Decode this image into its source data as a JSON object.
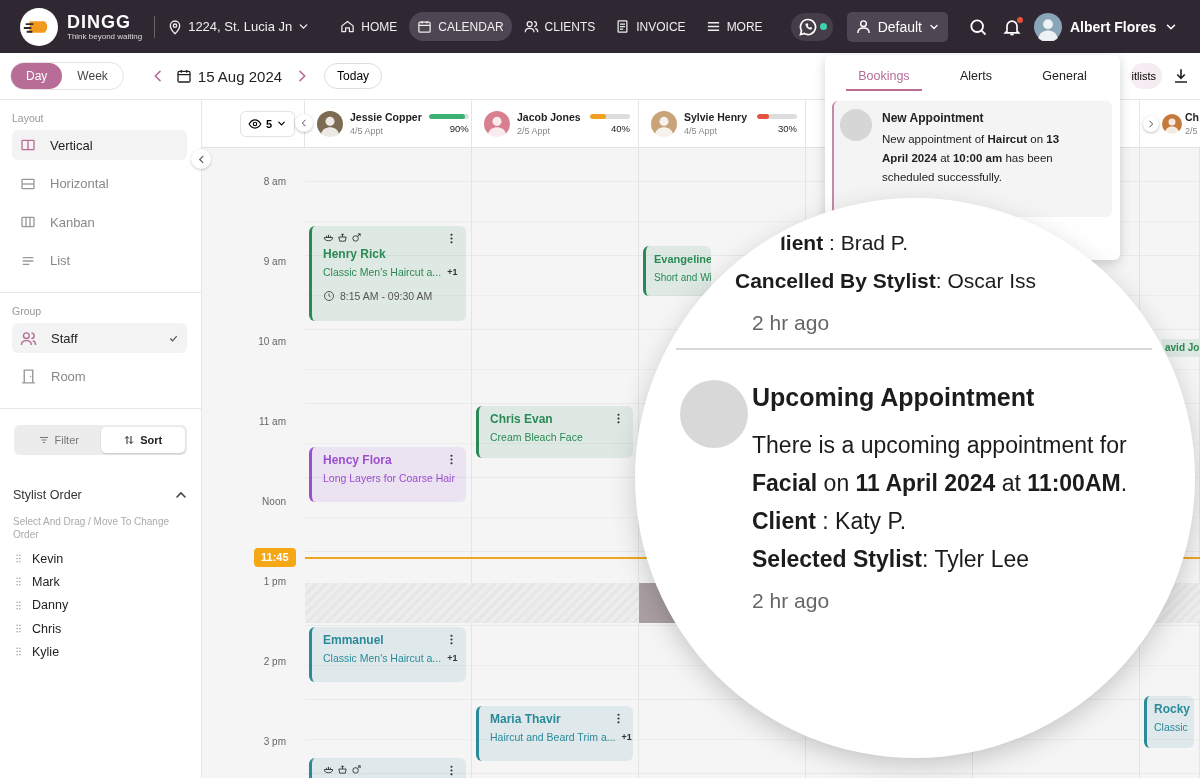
{
  "brand": {
    "name": "DINGG",
    "tagline": "Think beyond waiting"
  },
  "location": "1224, St. Lucia Jn",
  "nav": [
    {
      "label": "HOME",
      "selected": false
    },
    {
      "label": "CALENDAR",
      "selected": true
    },
    {
      "label": "CLIENTS",
      "selected": false
    },
    {
      "label": "INVOICE",
      "selected": false
    },
    {
      "label": "MORE",
      "selected": false
    }
  ],
  "whatsapp": {
    "online": true
  },
  "profile_switch": "Default",
  "bell": {
    "unread": true
  },
  "user": "Albert Flores",
  "view_toggle": [
    {
      "label": "Day",
      "selected": true
    },
    {
      "label": "Week",
      "selected": false
    }
  ],
  "date": "15 Aug 2024",
  "today": "Today",
  "waitlists": "itlists",
  "sidebar": {
    "layout_label": "Layout",
    "layouts": [
      {
        "label": "Vertical",
        "selected": true
      },
      {
        "label": "Horizontal",
        "selected": false
      },
      {
        "label": "Kanban",
        "selected": false
      },
      {
        "label": "List",
        "selected": false
      }
    ],
    "group_label": "Group",
    "groups": [
      {
        "label": "Staff",
        "selected": true
      },
      {
        "label": "Room",
        "selected": false
      }
    ],
    "modes": [
      {
        "label": "Filter",
        "selected": false
      },
      {
        "label": "Sort",
        "selected": true
      }
    ],
    "order": {
      "title": "Stylist Order",
      "expanded": true,
      "hint": "Select And Drag / Move To Change Order",
      "items": [
        "Kevin",
        "Mark",
        "Danny",
        "Chris",
        "Kylie"
      ]
    }
  },
  "calendar": {
    "visible_count": "5",
    "times": [
      "8 am",
      "9 am",
      "10 am",
      "11 am",
      "Noon",
      "1 pm",
      "2 pm",
      "3 pm"
    ],
    "now": "11:45",
    "staff": [
      {
        "name": "Jessie Copper",
        "appts": "4/5 Appt",
        "level": 0.9,
        "percent": "90%",
        "color": "#3bb273",
        "events": [
          {
            "name": "Henry Rick",
            "service": "Classic Men's Haircut a...",
            "extra": "+1",
            "time": "8:15 AM - 09:30 AM",
            "icons": true,
            "color": "#2a8a55"
          },
          {
            "name": "Hency Flora",
            "service": "Long Layers for Coarse Hair",
            "icons": false,
            "color": "#9b4fd0"
          },
          {
            "name": "Emmanuel",
            "service": "Classic Men's Haircut a...",
            "extra": "+1",
            "icons": false,
            "color": "#2a8a9a"
          },
          {
            "icons": true,
            "color": "#2a8a9a"
          }
        ]
      },
      {
        "name": "Jacob Jones",
        "appts": "2/5 Appt",
        "level": 0.4,
        "percent": "40%",
        "color": "#f0a020",
        "events": [
          {
            "name": "Chris Evan",
            "service": "Cream Bleach Face",
            "icons": false,
            "color": "#2a8a55"
          },
          {
            "name": "Maria Thavir",
            "service": "Haircut and Beard Trim a...",
            "extra": "+1",
            "icons": false,
            "color": "#2a8a9a"
          }
        ]
      },
      {
        "name": "Sylvie Henry",
        "appts": "4/5 Appt",
        "level": 0.3,
        "percent": "30%",
        "color": "#e5533d",
        "events": [
          {
            "name": "Evangeline",
            "service": "Short and Wi",
            "icons": false,
            "color": "#2a8a55"
          }
        ]
      },
      {
        "name": "Ch",
        "appts": "2/5",
        "events": [
          {
            "name": "avid Jo",
            "icons": false,
            "color": "#2a8a55"
          },
          {
            "name": "Rocky",
            "service": "Classic",
            "icons": false,
            "color": "#2a8a9a"
          }
        ]
      }
    ]
  },
  "notifications_panel": {
    "tabs": [
      {
        "label": "Bookings",
        "selected": true
      },
      {
        "label": "Alerts",
        "selected": false
      },
      {
        "label": "General",
        "selected": false
      }
    ],
    "items": [
      {
        "title": "New Appointment",
        "message": "New appointment of **Haircut** on **13 April 2024** at **10:00 am** has been scheduled successfully."
      }
    ]
  },
  "magnifier": {
    "previous": {
      "client": "**lient** : Brad P.",
      "cancelled_by": "**Cancelled By Stylist**: Oscar Iss",
      "time": "2 hr ago"
    },
    "current": {
      "title": "Upcoming Appointment",
      "message": "There is a upcoming appointment for **Facial** on **11 April 2024** at **11:00AM**.",
      "client": "**Client** : Katy P.",
      "stylist": "**Selected Stylist**: Tyler Lee",
      "time": "2 hr ago"
    }
  }
}
